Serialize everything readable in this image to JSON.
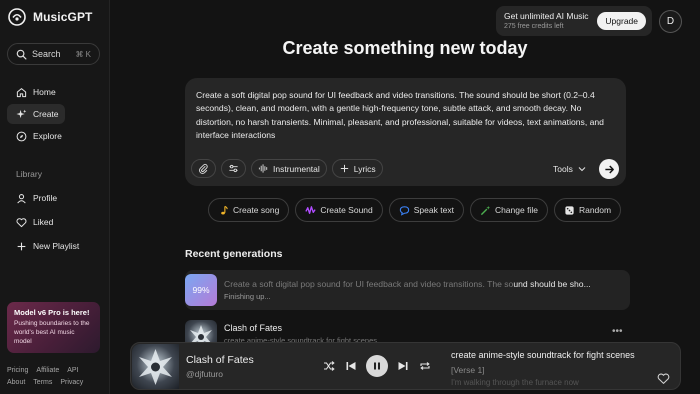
{
  "app": {
    "name": "MusicGPT"
  },
  "sidebar": {
    "search_label": "Search",
    "search_shortcut": "⌘ K",
    "nav": [
      {
        "label": "Home",
        "icon": "home-icon"
      },
      {
        "label": "Create",
        "icon": "sparkle-icon",
        "active": true
      },
      {
        "label": "Explore",
        "icon": "compass-icon"
      }
    ],
    "library_heading": "Library",
    "library": [
      {
        "label": "Profile",
        "icon": "user-icon"
      },
      {
        "label": "Liked",
        "icon": "heart-icon"
      },
      {
        "label": "New Playlist",
        "icon": "plus-icon"
      }
    ],
    "promo": {
      "title": "Model v6 Pro is here!",
      "body": "Pushing boundaries to the world's best AI music model"
    },
    "footer_links": [
      "Pricing",
      "Affiliate",
      "API",
      "About",
      "Terms",
      "Privacy"
    ]
  },
  "topbar": {
    "upgrade_title": "Get unlimited AI Music",
    "upgrade_subtitle": "275 free credits left",
    "upgrade_button": "Upgrade",
    "avatar_initial": "D"
  },
  "main": {
    "title": "Create something new today",
    "prompt_text": "Create a soft digital pop sound for UI feedback and video transitions. The sound should be short (0.2–0.4 seconds), clean, and modern, with a gentle high-frequency tone, subtle attack, and smooth decay. No distortion, no harsh transients. Minimal, pleasant, and professional, suitable for videos, text animations, and interface interactions",
    "tool_instrumental": "Instrumental",
    "tool_lyrics": "Lyrics",
    "tools_label": "Tools",
    "quick_actions": [
      {
        "label": "Create song",
        "icon": "music-note-icon",
        "color": "#f0b429"
      },
      {
        "label": "Create Sound",
        "icon": "waveform-icon",
        "color": "#b04cff"
      },
      {
        "label": "Speak text",
        "icon": "speech-bubble-icon",
        "color": "#3b82f6"
      },
      {
        "label": "Change file",
        "icon": "magic-wand-icon",
        "color": "#4caf50"
      },
      {
        "label": "Random",
        "icon": "dice-icon",
        "color": "#e5e5e5"
      }
    ],
    "recent_title": "Recent generations",
    "recent": [
      {
        "progress": "99%",
        "title_dim": "Create a soft digital pop sound for UI feedback and video transitions. The so",
        "title_bright": "und should be sho...",
        "status": "Finishing up..."
      },
      {
        "title": "Clash of Fates",
        "subtitle": "create anime-style soundtrack for fight scenes"
      }
    ]
  },
  "player": {
    "title": "Clash of Fates",
    "artist": "@djfuturo",
    "lyric_title": "create anime-style soundtrack for fight scenes",
    "lyric_line1": "[Verse 1]",
    "lyric_line2": "I'm walking through the furnace now"
  }
}
